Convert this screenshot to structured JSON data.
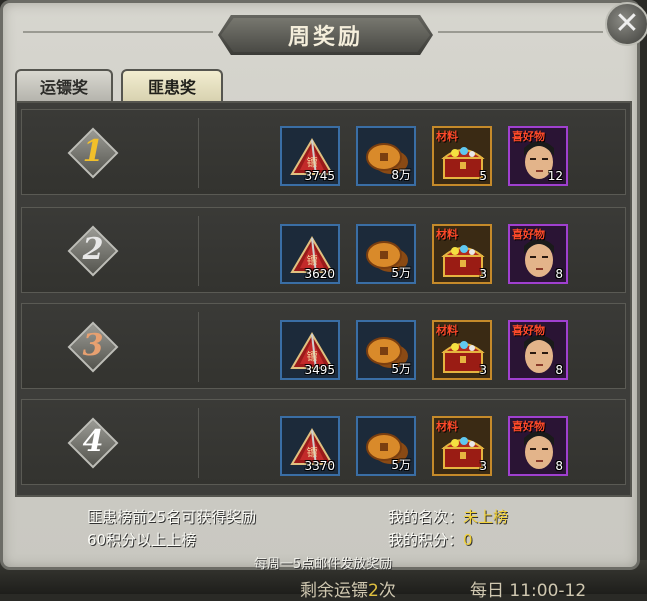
{
  "title": "周奖励",
  "close_icon": "close-icon",
  "tabs": [
    {
      "label": "运镖奖",
      "active": false
    },
    {
      "label": "匪患奖",
      "active": true
    }
  ],
  "rows": [
    {
      "rank": "1",
      "rank_color": "#f2c02a",
      "items": [
        {
          "icon": "flag-icon",
          "qty": "3745"
        },
        {
          "icon": "coin-icon",
          "qty": "8万"
        },
        {
          "icon": "chest-icon",
          "tag": "材料",
          "qty": "5"
        },
        {
          "icon": "portrait-icon",
          "tag": "喜好物",
          "qty": "12"
        }
      ]
    },
    {
      "rank": "2",
      "rank_color": "#e8e8e8",
      "items": [
        {
          "icon": "flag-icon",
          "qty": "3620"
        },
        {
          "icon": "coin-icon",
          "qty": "5万"
        },
        {
          "icon": "chest-icon",
          "tag": "材料",
          "qty": "3"
        },
        {
          "icon": "portrait-icon",
          "tag": "喜好物",
          "qty": "8"
        }
      ]
    },
    {
      "rank": "3",
      "rank_color": "#e8a070",
      "items": [
        {
          "icon": "flag-icon",
          "qty": "3495"
        },
        {
          "icon": "coin-icon",
          "qty": "5万"
        },
        {
          "icon": "chest-icon",
          "tag": "材料",
          "qty": "3"
        },
        {
          "icon": "portrait-icon",
          "tag": "喜好物",
          "qty": "8"
        }
      ]
    },
    {
      "rank": "4",
      "rank_color": "#ffffff",
      "items": [
        {
          "icon": "flag-icon",
          "qty": "3370"
        },
        {
          "icon": "coin-icon",
          "qty": "5万"
        },
        {
          "icon": "chest-icon",
          "tag": "材料",
          "qty": "3"
        },
        {
          "icon": "portrait-icon",
          "tag": "喜好物",
          "qty": "8"
        }
      ]
    }
  ],
  "info": {
    "line1": "匪患榜前25名可获得奖励",
    "line2": "60积分以上上榜",
    "my_rank_label": "我的名次：",
    "my_rank_value": "未上榜",
    "my_score_label": "我的积分：",
    "my_score_value": "0",
    "footer": "每周一5点邮件发放奖励"
  },
  "background": {
    "remaining_label": "剩余运镖",
    "remaining_count": "2",
    "remaining_unit": "次",
    "daily_label": "每日",
    "daily_time": "11:00-12"
  }
}
